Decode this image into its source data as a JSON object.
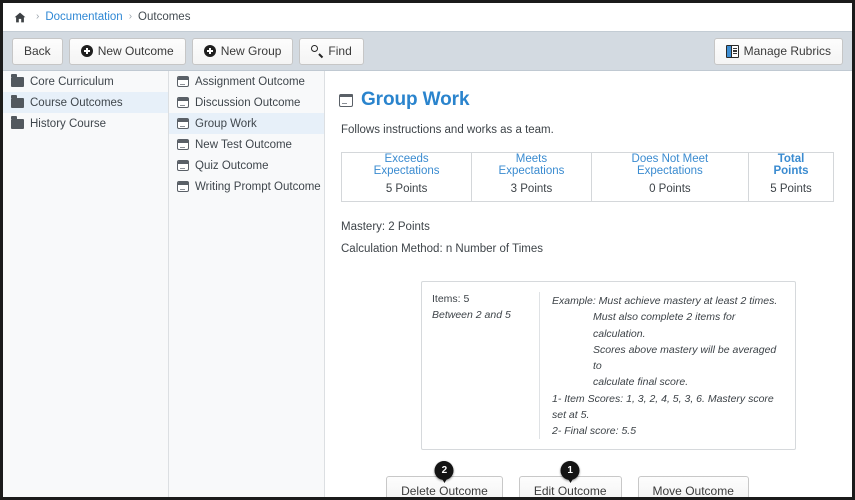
{
  "breadcrumb": {
    "home_icon": "home-icon",
    "items": [
      {
        "label": "Documentation",
        "link": true
      },
      {
        "label": "Outcomes",
        "link": false
      }
    ],
    "separator": "›"
  },
  "toolbar": {
    "back_label": "Back",
    "new_outcome_label": "New Outcome",
    "new_group_label": "New Group",
    "find_label": "Find",
    "manage_rubrics_label": "Manage Rubrics",
    "icons": {
      "plus": "plus-circle-icon",
      "search": "search-icon",
      "rubric": "rubric-icon"
    }
  },
  "groups_panel": {
    "items": [
      {
        "label": "Core Curriculum",
        "selected": false
      },
      {
        "label": "Course Outcomes",
        "selected": true
      },
      {
        "label": "History Course",
        "selected": false
      }
    ]
  },
  "outcomes_panel": {
    "items": [
      {
        "label": "Assignment Outcome",
        "selected": false
      },
      {
        "label": "Discussion Outcome",
        "selected": false
      },
      {
        "label": "Group Work",
        "selected": true
      },
      {
        "label": "New Test Outcome",
        "selected": false
      },
      {
        "label": "Quiz Outcome",
        "selected": false
      },
      {
        "label": "Writing Prompt Outcome",
        "selected": false
      }
    ]
  },
  "detail": {
    "title": "Group Work",
    "description": "Follows instructions and works as a team.",
    "ratings": {
      "headers": [
        {
          "label": "Exceeds Expectations",
          "bold": false
        },
        {
          "label": "Meets Expectations",
          "bold": false
        },
        {
          "label": "Does Not Meet Expectations",
          "bold": false
        },
        {
          "label": "Total Points",
          "bold": true
        }
      ],
      "points": [
        "5 Points",
        "3 Points",
        "0 Points",
        "5 Points"
      ]
    },
    "mastery": "Mastery: 2 Points",
    "calculation_method": "Calculation Method: n Number of Times",
    "example_box": {
      "left": {
        "items_line": "Items: 5",
        "range_line": "Between 2 and 5"
      },
      "right": {
        "line1": "Example: Must achieve mastery at least 2 times.",
        "line2": "Must also complete 2 items for calculation.",
        "line3": "Scores above mastery will be averaged to",
        "line4": "calculate final score.",
        "line5": "1- Item Scores: 1, 3, 2, 4, 5, 3, 6. Mastery score set at 5.",
        "line6": "2- Final score: 5.5"
      }
    },
    "actions": [
      {
        "label": "Delete Outcome",
        "badge": "2"
      },
      {
        "label": "Edit Outcome",
        "badge": "1"
      },
      {
        "label": "Move Outcome",
        "badge": null
      }
    ]
  },
  "colors": {
    "link_blue": "#2f88d5",
    "title_blue": "#2a84cd",
    "toolbar_bg": "#d3dae1",
    "selection_blue": "#e7f0f9",
    "badge_black": "#141414"
  }
}
